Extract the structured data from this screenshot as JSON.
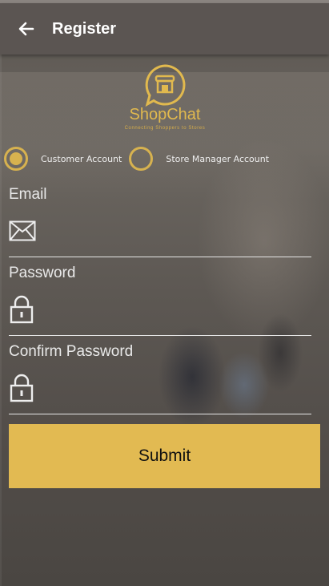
{
  "appbar": {
    "title": "Register",
    "back_icon": "arrow-left-icon"
  },
  "logo": {
    "brand": "ShopChat",
    "tagline": "Connecting Shoppers to Stores",
    "color": "#e1b94e"
  },
  "account_type": {
    "options": [
      {
        "label": "Customer Account",
        "selected": true
      },
      {
        "label": "Store Manager Account",
        "selected": false
      }
    ]
  },
  "form": {
    "email": {
      "label": "Email",
      "icon": "envelope-icon",
      "value": ""
    },
    "password": {
      "label": "Password",
      "icon": "lock-icon",
      "value": ""
    },
    "confirm_password": {
      "label": "Confirm Password",
      "icon": "lock-icon",
      "value": ""
    }
  },
  "submit_label": "Submit",
  "colors": {
    "accent": "#e2ba52",
    "appbar": "#5b5552"
  }
}
